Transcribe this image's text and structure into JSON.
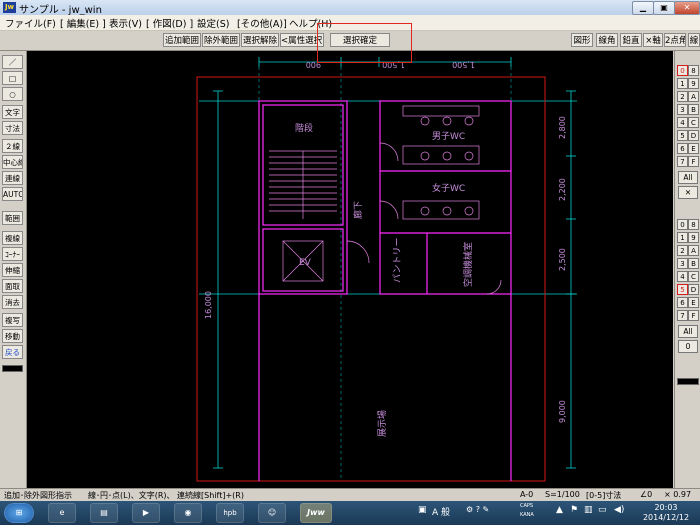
{
  "window": {
    "app_icon": "Jw",
    "title": "サンプル - jw_win",
    "controls": [
      "minimize-icon",
      "maximize-icon",
      "close-icon"
    ]
  },
  "menu": [
    "ファイル(F)",
    "[ 編集(E) ]",
    "表示(V)",
    "[ 作図(D) ]",
    "設定(S)",
    "[その他(A)]",
    "ヘルプ(H)"
  ],
  "toolbar": {
    "left_buttons": [
      "追加範囲",
      "除外範囲",
      "選択解除",
      "<属性選択>"
    ],
    "confirm_button": "選択確定",
    "right_buttons": [
      "図形",
      "線角",
      "鉛直",
      "×軸",
      "2点角",
      "線"
    ]
  },
  "left_tools": [
    {
      "label": "／"
    },
    {
      "label": "□"
    },
    {
      "label": "○"
    },
    {
      "label": "文字"
    },
    {
      "label": "寸法"
    },
    {
      "label": "２線"
    },
    {
      "label": "中心線"
    },
    {
      "label": "連線"
    },
    {
      "label": "AUTO"
    },
    {
      "label": "範囲"
    },
    {
      "label": "複線"
    },
    {
      "label": "ｺｰﾅｰ"
    },
    {
      "label": "伸縮"
    },
    {
      "label": "面取"
    },
    {
      "label": "消去"
    },
    {
      "label": "複写"
    },
    {
      "label": "移動"
    },
    {
      "label": "戻る",
      "accent": true
    }
  ],
  "right_layers": {
    "group1": [
      [
        "0",
        "8"
      ],
      [
        "1",
        "9"
      ],
      [
        "2",
        "A"
      ],
      [
        "3",
        "B"
      ],
      [
        "4",
        "C"
      ],
      [
        "5",
        "D"
      ],
      [
        "6",
        "E"
      ],
      [
        "7",
        "F"
      ]
    ],
    "all1": "All",
    "group2": [
      [
        "0",
        "8"
      ],
      [
        "1",
        "9"
      ],
      [
        "2",
        "A"
      ],
      [
        "3",
        "B"
      ],
      [
        "4",
        "C"
      ],
      [
        "5",
        "D"
      ],
      [
        "6",
        "E"
      ],
      [
        "7",
        "F"
      ]
    ],
    "all2": "All",
    "zero": "0",
    "accent": "#d42020"
  },
  "drawing": {
    "dims_top": [
      "900",
      "1,500",
      "1,500"
    ],
    "dim_left": "16,000",
    "dims_right": [
      "2,800",
      "2,200",
      "2,500",
      "9,000"
    ],
    "room_labels": [
      "階段",
      "男子WC",
      "女子WC",
      "EV",
      "パントリー",
      "空調機械室",
      "廊下",
      "展示場"
    ],
    "colors": {
      "wall": "#ff2bff",
      "dim": "#00d2d2",
      "frame": "#d01818",
      "rooms": "#e080e0",
      "text": "#c48cd8"
    }
  },
  "status": {
    "hint": "追加･除外図形指示",
    "mouse": "線･円･点(L)、文字(R)、 連続線[Shift]+(R)",
    "layer": "A-0",
    "scale": "S=1/100",
    "dim_mode": "[0-5]寸法",
    "angle": "∠0",
    "factor": "× 0.97"
  },
  "taskbar": {
    "apps": [
      "windows-start-icon",
      "ie-icon",
      "explorer-icon",
      "media-player-icon",
      "chrome-icon",
      "hpb",
      "game-icon",
      "Jww"
    ],
    "ime": "A 般",
    "caps": "CAPS",
    "kana": "KANA",
    "time": "20:03",
    "date": "2014/12/12"
  }
}
